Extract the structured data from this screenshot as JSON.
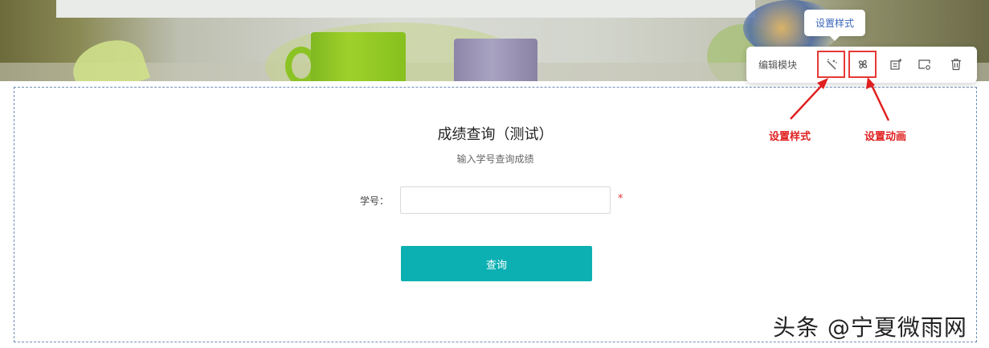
{
  "toolbar": {
    "title": "编辑模块",
    "tooltip": "设置样式",
    "buttons": [
      {
        "name": "style",
        "icon": "magic-wand-icon"
      },
      {
        "name": "animation",
        "icon": "pinwheel-icon"
      },
      {
        "name": "add",
        "icon": "add-module-icon"
      },
      {
        "name": "settings",
        "icon": "module-settings-icon"
      },
      {
        "name": "delete",
        "icon": "trash-icon"
      }
    ]
  },
  "annotations": {
    "style_label": "设置样式",
    "animation_label": "设置动画",
    "color": "#e02020"
  },
  "form": {
    "title": "成绩查询（测试）",
    "subtitle": "输入学号查询成绩",
    "field_label": "学号：",
    "field_value": "",
    "field_placeholder": "",
    "required_mark": "*",
    "submit_label": "查询",
    "accent_color": "#0cb0b2"
  },
  "watermark": "头条 @宁夏微雨网"
}
